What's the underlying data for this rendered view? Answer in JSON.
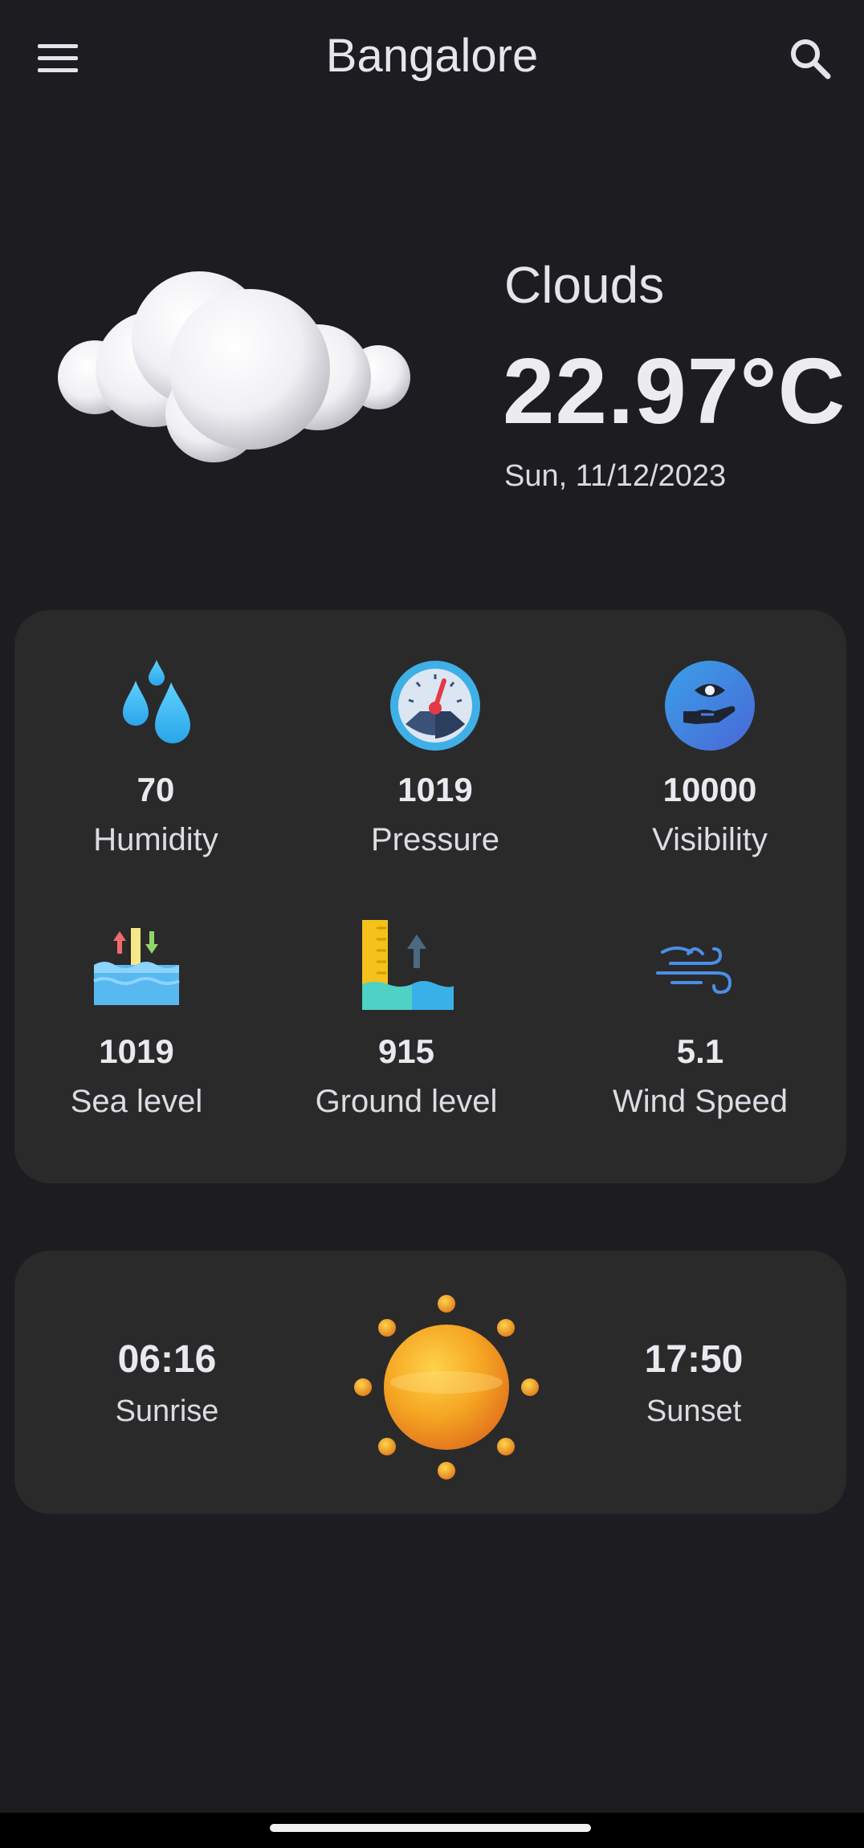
{
  "header": {
    "city": "Bangalore",
    "menu_icon": "menu-icon",
    "search_icon": "search-icon"
  },
  "current": {
    "condition": "Clouds",
    "temperature": "22.97°C",
    "date": "Sun, 11/12/2023",
    "condition_icon": "cloud-icon"
  },
  "details": [
    {
      "value": "70",
      "label": "Humidity",
      "icon": "humidity-icon"
    },
    {
      "value": "1019",
      "label": "Pressure",
      "icon": "pressure-gauge-icon"
    },
    {
      "value": "10000",
      "label": "Visibility",
      "icon": "visibility-icon"
    },
    {
      "value": "1019",
      "label": "Sea level",
      "icon": "sea-level-icon"
    },
    {
      "value": "915",
      "label": "Ground level",
      "icon": "ground-level-icon"
    },
    {
      "value": "5.1",
      "label": "Wind Speed",
      "icon": "wind-icon"
    }
  ],
  "sun": {
    "sunrise_time": "06:16",
    "sunrise_label": "Sunrise",
    "sunset_time": "17:50",
    "sunset_label": "Sunset",
    "icon": "sun-icon"
  },
  "colors": {
    "background": "#1d1c21",
    "card": "#2a2a2b",
    "text": "#e9e7ee"
  }
}
